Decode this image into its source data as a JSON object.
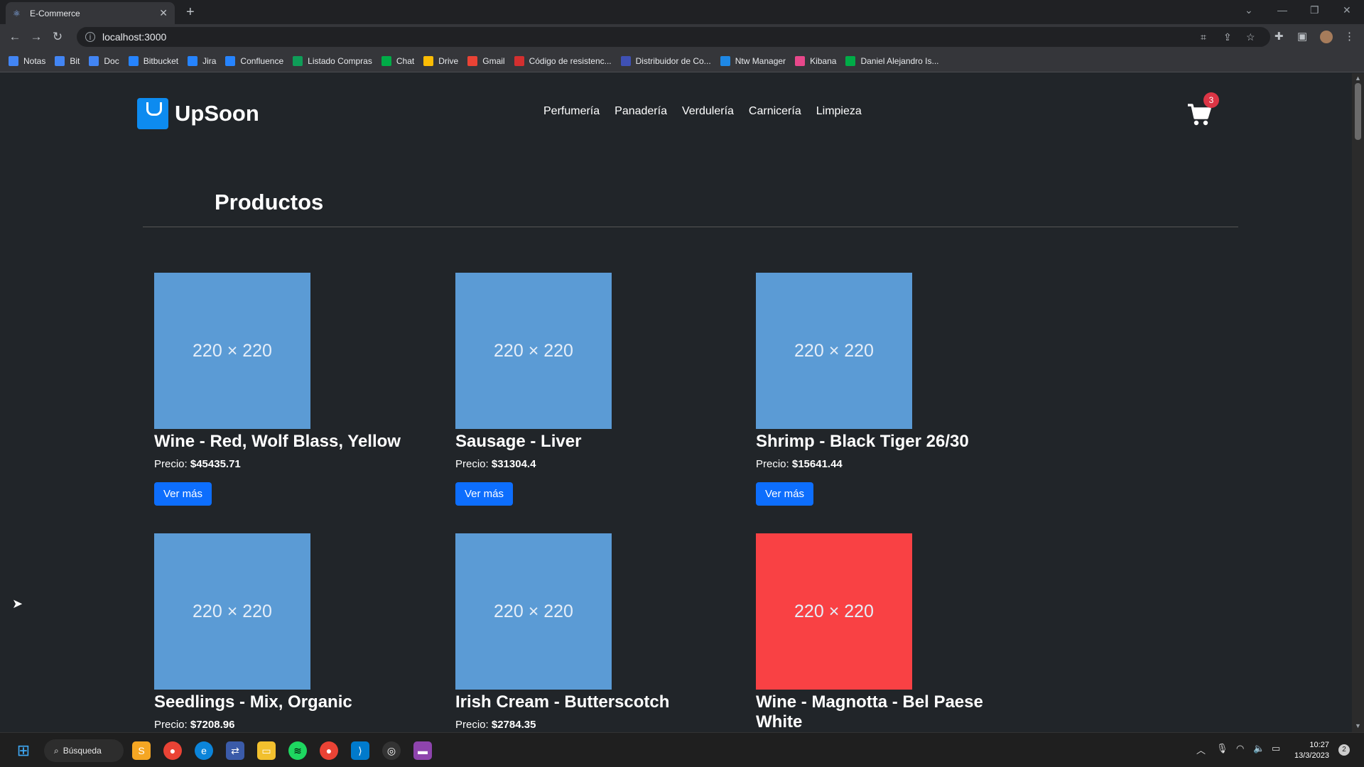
{
  "browser": {
    "tab_title": "E-Commerce",
    "url": "localhost:3000",
    "bookmarks": [
      {
        "label": "Notas",
        "color": "#4285f4"
      },
      {
        "label": "Bit",
        "color": "#4285f4"
      },
      {
        "label": "Doc",
        "color": "#4285f4"
      },
      {
        "label": "Bitbucket",
        "color": "#2684ff"
      },
      {
        "label": "Jira",
        "color": "#2684ff"
      },
      {
        "label": "Confluence",
        "color": "#2684ff"
      },
      {
        "label": "Listado Compras",
        "color": "#0f9d58"
      },
      {
        "label": "Chat",
        "color": "#00ac47"
      },
      {
        "label": "Drive",
        "color": "#fbbc04"
      },
      {
        "label": "Gmail",
        "color": "#ea4335"
      },
      {
        "label": "Código de resistenc...",
        "color": "#d32f2f"
      },
      {
        "label": "Distribuidor de Co...",
        "color": "#3f51b5"
      },
      {
        "label": "Ntw Manager",
        "color": "#1e88e5"
      },
      {
        "label": "Kibana",
        "color": "#e8488b"
      },
      {
        "label": "Daniel Alejandro Is...",
        "color": "#00ac47"
      }
    ]
  },
  "site": {
    "brand": "UpSoon",
    "nav": [
      "Perfumería",
      "Panadería",
      "Verdulería",
      "Carnicería",
      "Limpieza"
    ],
    "cart_count": "3",
    "section_title": "Productos",
    "price_label": "Precio:",
    "button_label": "Ver más",
    "products": [
      {
        "image_text": "220 × 220",
        "name": "Wine - Red, Wolf Blass, Yellow",
        "price": "$45435.71",
        "image_color": "#5b9bd5"
      },
      {
        "image_text": "220 × 220",
        "name": "Sausage - Liver",
        "price": "$31304.4",
        "image_color": "#5b9bd5"
      },
      {
        "image_text": "220 × 220",
        "name": "Shrimp - Black Tiger 26/30",
        "price": "$15641.44",
        "image_color": "#5b9bd5"
      },
      {
        "image_text": "220 × 220",
        "name": "Seedlings - Mix, Organic",
        "price": "$7208.96",
        "image_color": "#5b9bd5"
      },
      {
        "image_text": "220 × 220",
        "name": "Irish Cream - Butterscotch",
        "price": "$2784.35",
        "image_color": "#5b9bd5"
      },
      {
        "image_text": "220 × 220",
        "name": "Wine - Magnotta - Bel Paese White",
        "price": "",
        "image_color": "#f94144"
      }
    ]
  },
  "taskbar": {
    "search_label": "Búsqueda",
    "time": "10:27",
    "date": "13/3/2023",
    "notifications": "2"
  }
}
